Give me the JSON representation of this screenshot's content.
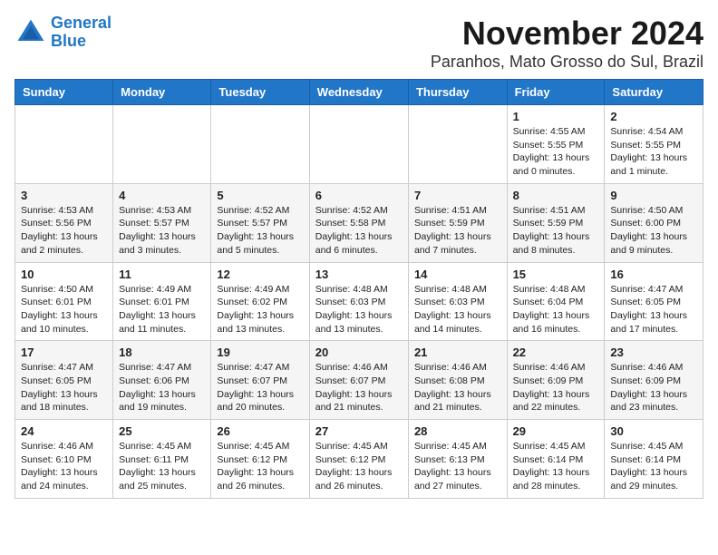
{
  "logo": {
    "line1": "General",
    "line2": "Blue"
  },
  "header": {
    "month": "November 2024",
    "location": "Paranhos, Mato Grosso do Sul, Brazil"
  },
  "weekdays": [
    "Sunday",
    "Monday",
    "Tuesday",
    "Wednesday",
    "Thursday",
    "Friday",
    "Saturday"
  ],
  "weeks": [
    [
      {
        "day": "",
        "info": ""
      },
      {
        "day": "",
        "info": ""
      },
      {
        "day": "",
        "info": ""
      },
      {
        "day": "",
        "info": ""
      },
      {
        "day": "",
        "info": ""
      },
      {
        "day": "1",
        "info": "Sunrise: 4:55 AM\nSunset: 5:55 PM\nDaylight: 13 hours and 0 minutes."
      },
      {
        "day": "2",
        "info": "Sunrise: 4:54 AM\nSunset: 5:55 PM\nDaylight: 13 hours and 1 minute."
      }
    ],
    [
      {
        "day": "3",
        "info": "Sunrise: 4:53 AM\nSunset: 5:56 PM\nDaylight: 13 hours and 2 minutes."
      },
      {
        "day": "4",
        "info": "Sunrise: 4:53 AM\nSunset: 5:57 PM\nDaylight: 13 hours and 3 minutes."
      },
      {
        "day": "5",
        "info": "Sunrise: 4:52 AM\nSunset: 5:57 PM\nDaylight: 13 hours and 5 minutes."
      },
      {
        "day": "6",
        "info": "Sunrise: 4:52 AM\nSunset: 5:58 PM\nDaylight: 13 hours and 6 minutes."
      },
      {
        "day": "7",
        "info": "Sunrise: 4:51 AM\nSunset: 5:59 PM\nDaylight: 13 hours and 7 minutes."
      },
      {
        "day": "8",
        "info": "Sunrise: 4:51 AM\nSunset: 5:59 PM\nDaylight: 13 hours and 8 minutes."
      },
      {
        "day": "9",
        "info": "Sunrise: 4:50 AM\nSunset: 6:00 PM\nDaylight: 13 hours and 9 minutes."
      }
    ],
    [
      {
        "day": "10",
        "info": "Sunrise: 4:50 AM\nSunset: 6:01 PM\nDaylight: 13 hours and 10 minutes."
      },
      {
        "day": "11",
        "info": "Sunrise: 4:49 AM\nSunset: 6:01 PM\nDaylight: 13 hours and 11 minutes."
      },
      {
        "day": "12",
        "info": "Sunrise: 4:49 AM\nSunset: 6:02 PM\nDaylight: 13 hours and 13 minutes."
      },
      {
        "day": "13",
        "info": "Sunrise: 4:48 AM\nSunset: 6:03 PM\nDaylight: 13 hours and 13 minutes."
      },
      {
        "day": "14",
        "info": "Sunrise: 4:48 AM\nSunset: 6:03 PM\nDaylight: 13 hours and 14 minutes."
      },
      {
        "day": "15",
        "info": "Sunrise: 4:48 AM\nSunset: 6:04 PM\nDaylight: 13 hours and 16 minutes."
      },
      {
        "day": "16",
        "info": "Sunrise: 4:47 AM\nSunset: 6:05 PM\nDaylight: 13 hours and 17 minutes."
      }
    ],
    [
      {
        "day": "17",
        "info": "Sunrise: 4:47 AM\nSunset: 6:05 PM\nDaylight: 13 hours and 18 minutes."
      },
      {
        "day": "18",
        "info": "Sunrise: 4:47 AM\nSunset: 6:06 PM\nDaylight: 13 hours and 19 minutes."
      },
      {
        "day": "19",
        "info": "Sunrise: 4:47 AM\nSunset: 6:07 PM\nDaylight: 13 hours and 20 minutes."
      },
      {
        "day": "20",
        "info": "Sunrise: 4:46 AM\nSunset: 6:07 PM\nDaylight: 13 hours and 21 minutes."
      },
      {
        "day": "21",
        "info": "Sunrise: 4:46 AM\nSunset: 6:08 PM\nDaylight: 13 hours and 21 minutes."
      },
      {
        "day": "22",
        "info": "Sunrise: 4:46 AM\nSunset: 6:09 PM\nDaylight: 13 hours and 22 minutes."
      },
      {
        "day": "23",
        "info": "Sunrise: 4:46 AM\nSunset: 6:09 PM\nDaylight: 13 hours and 23 minutes."
      }
    ],
    [
      {
        "day": "24",
        "info": "Sunrise: 4:46 AM\nSunset: 6:10 PM\nDaylight: 13 hours and 24 minutes."
      },
      {
        "day": "25",
        "info": "Sunrise: 4:45 AM\nSunset: 6:11 PM\nDaylight: 13 hours and 25 minutes."
      },
      {
        "day": "26",
        "info": "Sunrise: 4:45 AM\nSunset: 6:12 PM\nDaylight: 13 hours and 26 minutes."
      },
      {
        "day": "27",
        "info": "Sunrise: 4:45 AM\nSunset: 6:12 PM\nDaylight: 13 hours and 26 minutes."
      },
      {
        "day": "28",
        "info": "Sunrise: 4:45 AM\nSunset: 6:13 PM\nDaylight: 13 hours and 27 minutes."
      },
      {
        "day": "29",
        "info": "Sunrise: 4:45 AM\nSunset: 6:14 PM\nDaylight: 13 hours and 28 minutes."
      },
      {
        "day": "30",
        "info": "Sunrise: 4:45 AM\nSunset: 6:14 PM\nDaylight: 13 hours and 29 minutes."
      }
    ]
  ]
}
